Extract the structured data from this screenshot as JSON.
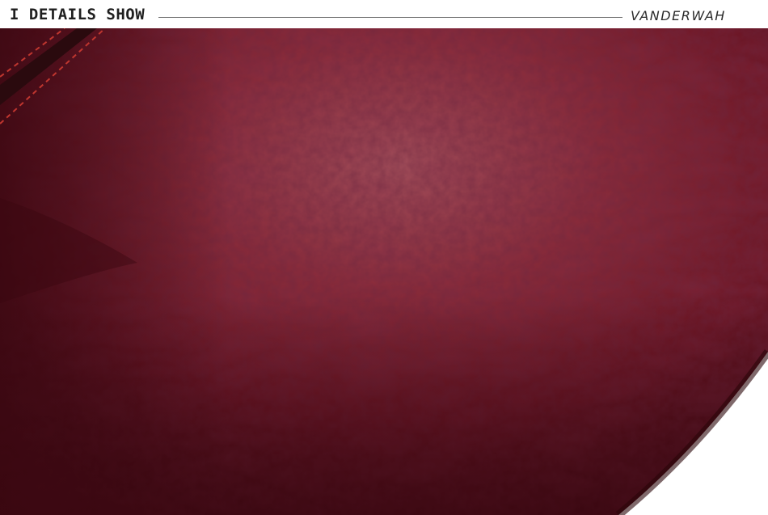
{
  "header": {
    "title": "I DETAILS SHOW",
    "brand": "VANDERWAH"
  },
  "photo": {
    "subject": "leather-texture-closeup",
    "colors": {
      "leather_base": "#6b1321",
      "leather_highlight": "#a5505b",
      "leather_shadow": "#3a0710",
      "stitch": "#c0362f",
      "zipper": "#2a0a0e",
      "background": "#ffffff"
    }
  }
}
